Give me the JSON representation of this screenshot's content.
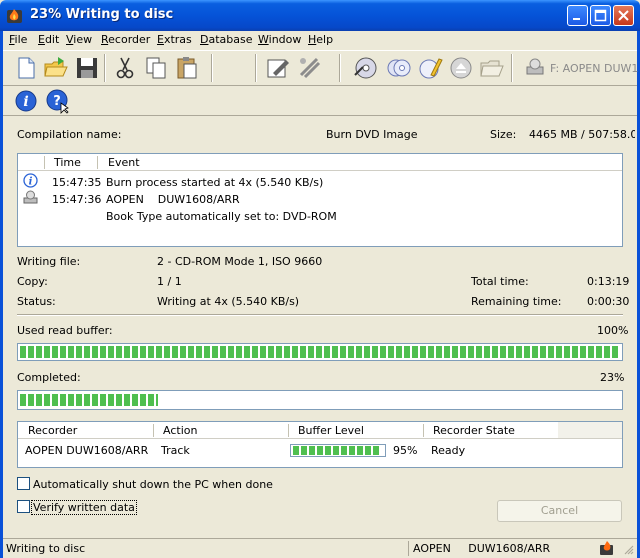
{
  "window": {
    "title": "23% Writing to disc"
  },
  "menu": {
    "items": [
      "File",
      "Edit",
      "View",
      "Recorder",
      "Extras",
      "Database",
      "Window",
      "Help"
    ]
  },
  "toolbar": {
    "drive_label": "F: AOPEN     DUW1",
    "icons": [
      "new-document-icon",
      "open-folder-icon",
      "save-icon",
      "cut-icon",
      "copy-icon",
      "paste-icon",
      "edit-compilation-icon",
      "burn-icon",
      "disc-copy-icon",
      "disc-info-icon",
      "write-pencil-icon",
      "eject-icon",
      "folder-icon",
      "drive-icon",
      "info-icon",
      "help-icon"
    ]
  },
  "compilation": {
    "name_label": "Compilation name:",
    "name_value": "Burn DVD Image",
    "size_label": "Size:",
    "size_value": "4465 MB   /   507:58.0"
  },
  "log": {
    "columns": [
      "Time",
      "Event"
    ],
    "rows": [
      {
        "icon": "info-icon",
        "time": "15:47:35",
        "event": "Burn process started at 4x (5.540 KB/s)"
      },
      {
        "icon": "drive-icon",
        "time": "15:47:36",
        "event": "AOPEN    DUW1608/ARR"
      },
      {
        "icon": "",
        "time": "",
        "event": "Book Type automatically set to: DVD-ROM"
      }
    ]
  },
  "status": {
    "writing_file_label": "Writing file:",
    "writing_file_value": "2 - CD-ROM Mode 1, ISO 9660",
    "copy_label": "Copy:",
    "copy_value": "1 / 1",
    "total_time_label": "Total time:",
    "total_time_value": "0:13:19",
    "status_label": "Status:",
    "status_value": "Writing at 4x (5.540 KB/s)",
    "remaining_label": "Remaining time:",
    "remaining_value": "0:00:30"
  },
  "buffer": {
    "label": "Used read buffer:",
    "percent_text": "100%",
    "level": 1.0
  },
  "completed": {
    "label": "Completed:",
    "percent_text": "23%",
    "level": 0.23
  },
  "recorders": {
    "columns": [
      "Recorder",
      "Action",
      "Buffer Level",
      "Recorder State"
    ],
    "rows": [
      {
        "recorder": "AOPEN DUW1608/ARR",
        "action": "Track",
        "buffer_text": "95%",
        "buffer_level": 0.95,
        "state": "Ready"
      }
    ]
  },
  "options": {
    "shutdown_label": "Automatically shut down the PC when done",
    "verify_label": "Verify written data",
    "shutdown_checked": false,
    "verify_checked": false
  },
  "buttons": {
    "cancel_label": "Cancel"
  },
  "statusbar": {
    "left_text": "Writing to disc",
    "drive_text": "AOPEN     DUW1608/ARR"
  },
  "colors": {
    "titlebar": "#0553d8",
    "progress_fill": "#4fbf4f",
    "window_bg": "#ece9d8"
  }
}
